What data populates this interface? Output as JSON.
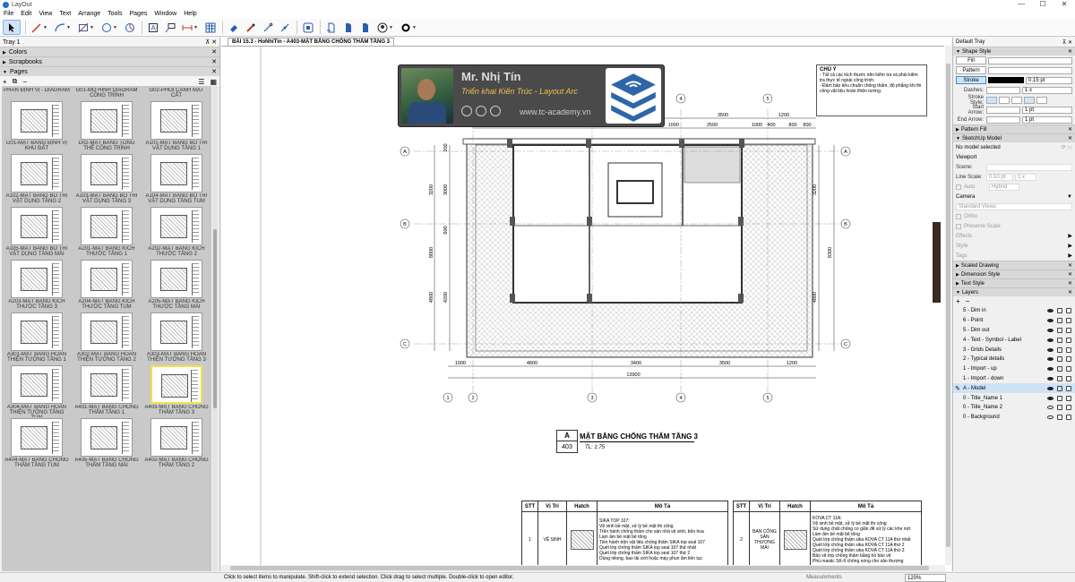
{
  "window": {
    "title": "LayOut",
    "minimize": "—",
    "maximize": "☐",
    "close": "✕"
  },
  "menu": [
    "File",
    "Edit",
    "View",
    "Text",
    "Arrange",
    "Tools",
    "Pages",
    "Window",
    "Help"
  ],
  "left_tray": {
    "title": "Tray 1",
    "panels": {
      "colors": "Colors",
      "scrapbooks": "Scrapbooks",
      "pages": "Pages"
    },
    "pages_top_labels": [
      "PHÂN ĐỊNH VỊ - DIAGRAM",
      "G01-MÔ HÌNH DIAGRAM CÔNG TRÌNH",
      "G02-PHỐI CẢNH MẶT CẮT"
    ],
    "pages": [
      "D01-MẶT BẰNG ĐỊNH VỊ KHU ĐẤT",
      "D02-MẶT BẰNG TỔNG THỂ CÔNG TRÌNH",
      "A101-MẶT BẰNG BỐ TRÍ VẬT DỤNG TẦNG 1",
      "A102-MẶT BẰNG BỐ TRÍ VẬT DỤNG TẦNG 2",
      "A103-MẶT BẰNG BỐ TRÍ VẬT DỤNG TẦNG 3",
      "A104-MẶT BẰNG BỐ TRÍ VẬT DỤNG TẦNG TUM",
      "A105-MẶT BẰNG BỐ TRÍ VẬT DỤNG TẦNG MÁI",
      "A201-MẶT BẰNG KÍCH THƯỚC TẦNG 1",
      "A202-MẶT BẰNG KÍCH THƯỚC TẦNG 2",
      "A203-MẶT BẰNG KÍCH THƯỚC TẦNG 3",
      "A204-MẶT BẰNG KÍCH THƯỚC TẦNG TUM",
      "A205-MẶT BẰNG KÍCH THƯỚC TẦNG MÁI",
      "A301-MẶT BẰNG HOÀN THIỆN TƯỜNG TẦNG 1",
      "A302-MẶT BẰNG HOÀN THIỆN TƯỜNG TẦNG 2",
      "A303-MẶT BẰNG HOÀN THIỆN TƯỜNG TẦNG 3",
      "A304-MẶT BẰNG HOÀN THIỆN TƯỜNG TẦNG TUM",
      "A401-MẶT BẰNG CHỐNG THẤM TẦNG 1",
      "A403-MẶT BẰNG CHỐNG THẤM TẦNG 3",
      "A404-MẶT BẰNG CHỐNG THẤM TẦNG TUM",
      "A405-MẶT BẰNG CHỐNG THẤM TẦNG MÁI",
      "A402-MẶT BẰNG CHỐNG THẤM TẦNG 2"
    ],
    "selected_page_index": 17
  },
  "document": {
    "tab": "BÀI 15.3 - HoNhiTin - A403-MẶT BẰNG CHỐNG THẤM TẦNG 3",
    "banner": {
      "name": "Mr. Nhị Tín",
      "subtitle": "Triển khai Kiến Trúc - Layout Arc",
      "website": "www.tc-academy.vn"
    },
    "note": {
      "title": "CHÚ Ý",
      "lines": [
        "- Tất cả các kích thước nên kiểm tra và phải kiểm tra thực tế ngoài công trình.",
        "- Đảm bảo tiêu chuẩn chống thấm, độ phẳng khi thi công vật liệu hoàn thiện tường."
      ]
    },
    "dims_top": [
      "3500",
      "1200",
      "1000",
      "2500",
      "1000",
      "400",
      "800",
      "800",
      "200"
    ],
    "dims_bottom": [
      "1000",
      "4800",
      "3400",
      "3500",
      "1200"
    ],
    "dim_total": "13900",
    "dims_left": [
      "200",
      "3200",
      "3000",
      "600",
      "8000",
      "4800",
      "4200"
    ],
    "dims_right": [
      "3200",
      "8300",
      "4800"
    ],
    "grid_letters": [
      "A",
      "B",
      "C"
    ],
    "grid_numbers": [
      "1",
      "2",
      "3",
      "4",
      "5"
    ],
    "drawing_title": {
      "letter": "A",
      "number": "403",
      "name": "MẶT BẰNG CHỐNG THẤM TẦNG 3",
      "scale": "TL: 1:75"
    },
    "schedule_headers": [
      "STT",
      "Vị Trí",
      "Hatch",
      "Mô Tả"
    ],
    "schedule_left": {
      "stt": "1",
      "location": "VỆ SINH",
      "desc": "SIKA TOP 107:\nVệ sinh bề mặt, xử lý bề mặt thi công\nTrên hành chống thấm cho sàn nhà vệ sinh, bồn hoa\nLàm ẩm bề mặt bê tông\nTiến hành trộn vật liệu chống thấm SIKA top seal 107\nQuét lớp chống thấm SIKA top seal 107 thứ nhất\nQuét lớp chống thấm SIKA top seal 107 thứ 2\nDùng nilong, bao tải ướt hoặc máy phun ẩm liên tục"
    },
    "schedule_right": {
      "stt": "2",
      "location": "BAN CÔNG SÂN THƯỢNG MÁI",
      "desc": "KOVA CT 11A:\nVệ sinh bề mặt, xử lý bề mặt thi công\nSử dụng chất chống co giãn để xử lý các khe nứt\nLàm ẩm bề mặt bê tông\nQuét lớp chống thấm sika KOVA CT 11A thứ nhất\nQuét lớp chống thấm sika KOVA CT 11A thứ 2\nQuét lớp chống thấm sika KOVA CT 11A thứ 3\nBảo vệ lớp chống thấm bằng hồ bảo vệ\nPhủ mastic SK-6 chống nóng cho sân thượng"
    }
  },
  "right_tray": {
    "title": "Default Tray",
    "shape_style": {
      "header": "Shape Style",
      "fill": "Fill",
      "pattern": "Pattern",
      "stroke": "Stroke",
      "stroke_width": "0.15 pt",
      "dashes_label": "Dashes:",
      "dashes_value": "1 x",
      "stroke_style_label": "Stroke Style:",
      "start_arrow_label": "Start Arrow:",
      "start_arrow_value": "1 pt",
      "end_arrow_label": "End Arrow:",
      "end_arrow_value": "1 pt"
    },
    "pattern_fill": "Pattern Fill",
    "sketchup_model": {
      "header": "SketchUp Model",
      "status": "No model selected",
      "viewport": "Viewport",
      "scene": "Scene:",
      "line_scale": "Line Scale:",
      "line_scale_value": "0.10 pt",
      "line_scale_mult": "1 x",
      "auto": "Auto",
      "hybrid": "Hybrid",
      "camera": "Camera",
      "standard_views": "Standard Views",
      "ortho": "Ortho",
      "preserve_scale": "Preserve Scale",
      "effects": "Effects",
      "style": "Style",
      "tags": "Tags"
    },
    "sections": {
      "scaled_drawing": "Scaled Drawing",
      "dimension_style": "Dimension Style",
      "text_style": "Text Style",
      "layers": "Layers"
    },
    "layers": [
      "5 - Dim in",
      "6 - Point",
      "5 - Dim out",
      "4 - Text - Symbol - Label",
      "3 - Grids Details",
      "2 - Typical details",
      "1 - Import - up",
      "1 - Import - down",
      "A - Model",
      "0 - Title_Name 1",
      "0 - Title_Name 2",
      "0 - Background"
    ],
    "active_layer_index": 8
  },
  "status": {
    "message": "Click to select items to manipulate. Shift-click to extend selection. Click drag to select multiple. Double-click to open editor.",
    "measurements_label": "Measurements",
    "zoom": "120%"
  }
}
